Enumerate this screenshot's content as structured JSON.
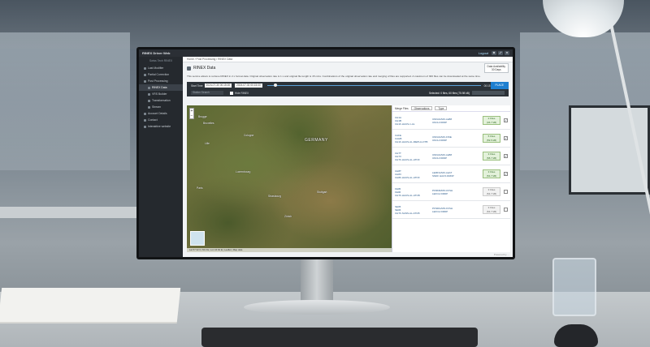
{
  "app": {
    "title": "RINEX Driver Web",
    "user": "Logout",
    "icons": [
      "settings-icon",
      "fullscreen-icon",
      "close-icon"
    ]
  },
  "sidebar": {
    "brand": "Swiss Tech RINEX",
    "items": [
      {
        "label": "Last Modifier",
        "sub": false,
        "active": false
      },
      {
        "label": "Partial Correction",
        "sub": false,
        "active": false
      },
      {
        "label": "Post Processing",
        "sub": false,
        "active": false
      },
      {
        "label": "RINEX Data",
        "sub": true,
        "active": true
      },
      {
        "label": "VRS Builder",
        "sub": true,
        "active": false
      },
      {
        "label": "Transformation",
        "sub": true,
        "active": false
      },
      {
        "label": "Stream",
        "sub": true,
        "active": false
      },
      {
        "label": "Account Details",
        "sub": false,
        "active": false
      },
      {
        "label": "Contact",
        "sub": false,
        "active": false
      },
      {
        "label": "Interaktive website",
        "sub": false,
        "active": false
      }
    ]
  },
  "breadcrumb": [
    "Home",
    "Post Processing",
    "RINEX Data"
  ],
  "page": {
    "title": "RINEX Data",
    "availability_label": "Data Availability",
    "availability_value": "30 Days",
    "description": "This service allows to retrieve RINEX in 2.x format data. Original observation rate is 1 s and original file length is 15 mins. Combinations of the original observation rate and merging of files are supported. A maximum of 300 files can be downloaded at the same time."
  },
  "timebar": {
    "start_label": "Start Time",
    "start_value": "2024-07-30 00:15:00",
    "end_value": "2024-07-30 00:15:00",
    "end_display": "00:15",
    "apply_label": "PLACE"
  },
  "filters": {
    "search_placeholder": "Station Search",
    "checkbox_label": "Hide RINEX",
    "selected_text": "Selected: 0 files, 60 files (75.98 kB)",
    "sort_label": "Merge Files",
    "option_label": "Observations",
    "type_label": "Type"
  },
  "map": {
    "country": "GERMANY",
    "labels": [
      "Bruxelles",
      "Brugge",
      "Cologne",
      "Lille",
      "Luxembourg",
      "Strasbourg",
      "Stuttgart",
      "Paris",
      "Zürich"
    ],
    "attribution": "Lat 57.32 N, 84.0 E, Lon 16.62 E | Leaflet | Map data"
  },
  "stations": [
    {
      "code": "CH1A",
      "net1": "CH1B",
      "net2": "CH1F-HAUS-1-AL",
      "mount1": "UNFAG/MO-LE88",
      "mount2": "UNCH DRDP",
      "files": "2 Files",
      "size": "(46.7 kB)",
      "checked": true
    },
    {
      "code": "CAFE",
      "net1": "CAHB",
      "net2": "CH1F-HAUS-AL-MEPH-LOTB",
      "mount1": "UNFAG/MO-FINE",
      "mount2": "UNCH DRDP",
      "files": "5 Files",
      "size": "(59.5 kB)",
      "checked": true
    },
    {
      "code": "CH7T",
      "net1": "CH7V",
      "net2": "CH7F-HAUS-AL-ATNX",
      "mount1": "UNFAG/MO-LE88",
      "mount2": "UNCH DRDP",
      "files": "3 Files",
      "size": "(58.7 kB)",
      "checked": true
    },
    {
      "code": "CH8T",
      "net1": "CH8V",
      "net2": "CH8F-HAUS-AL-ATNX",
      "mount1": "LEMFG/MO-LEAT",
      "mount2": "SNDF HAUS DRDP",
      "files": "3 Files",
      "size": "(54.7 kB)",
      "checked": true
    },
    {
      "code": "FE05",
      "net1": "FE06",
      "net2": "CH7F-HAUS-AL-ATCB",
      "mount1": "PFMND/MO-FFSH",
      "mount2": "LEFCH DRDP",
      "files": "3 Files",
      "size": "(54.7 kB)",
      "checked": false
    },
    {
      "code": "SE05",
      "net1": "SE06",
      "net2": "CH7F-SANS-AL-ATCB",
      "mount1": "PFNDG/MO-FFSH",
      "mount2": "LEFCH DRDP",
      "files": "3 Files",
      "size": "(54.7 kB)",
      "checked": false
    }
  ],
  "footer": "Powered by ..."
}
